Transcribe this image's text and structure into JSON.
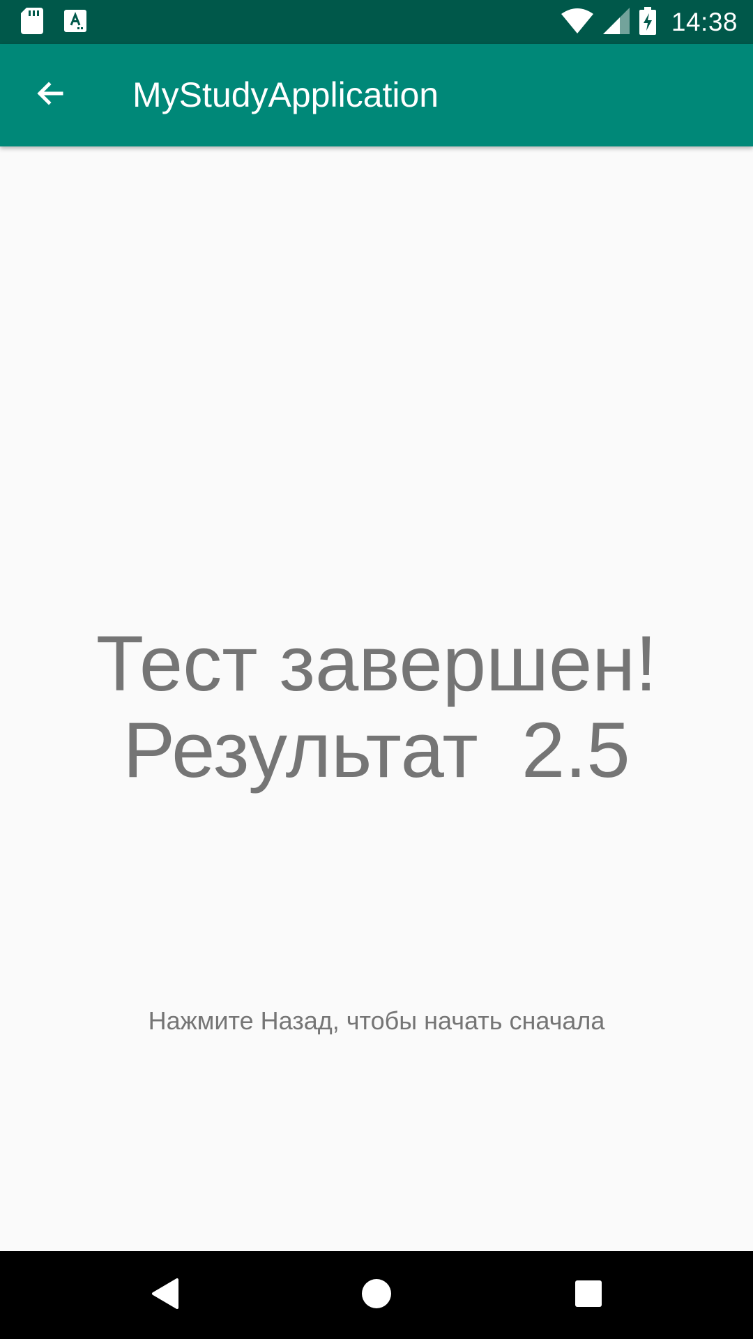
{
  "status_bar": {
    "time": "14:38",
    "icons": [
      "sd-card-icon",
      "keyboard-a-icon",
      "wifi-icon",
      "signal-icon",
      "battery-charging-icon"
    ]
  },
  "app_bar": {
    "title": "MyStudyApplication",
    "background": "#008878",
    "back_icon": "arrow-back-icon"
  },
  "main": {
    "result_line1": "Тест завершен!",
    "result_line2": "Результат  2.5",
    "hint": "Нажмите Назад, чтобы начать сначала",
    "text_color": "#757575"
  },
  "nav_bar": {
    "buttons": [
      "back-triangle-icon",
      "home-circle-icon",
      "recents-square-icon"
    ]
  }
}
